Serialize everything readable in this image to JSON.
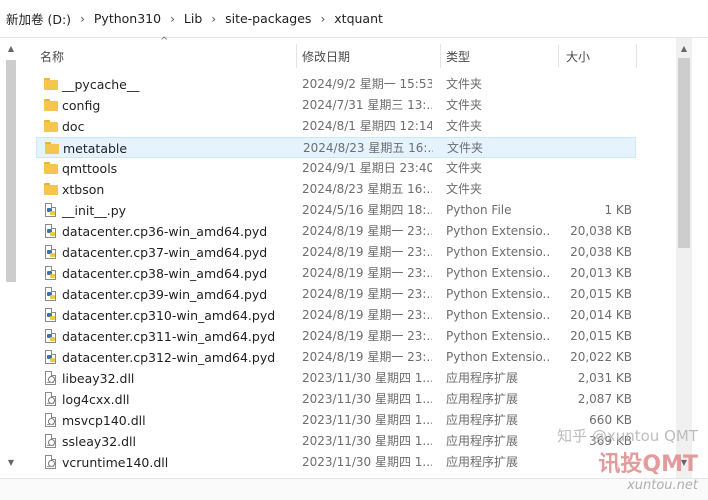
{
  "breadcrumb": [
    {
      "label": "新加卷 (D:)"
    },
    {
      "label": "Python310"
    },
    {
      "label": "Lib"
    },
    {
      "label": "site-packages"
    },
    {
      "label": "xtquant"
    }
  ],
  "separator_glyph": "›",
  "columns": {
    "name": "名称",
    "date": "修改日期",
    "type": "类型",
    "size": "大小"
  },
  "icons": {
    "folder": "folder-icon",
    "python": "python-file-icon",
    "pyd": "python-extension-icon",
    "dll": "dll-file-icon"
  },
  "rows": [
    {
      "name": "__pycache__",
      "date": "2024/9/2 星期一 15:53",
      "type": "文件夹",
      "size": "",
      "kind": "folder"
    },
    {
      "name": "config",
      "date": "2024/7/31 星期三 13:...",
      "type": "文件夹",
      "size": "",
      "kind": "folder"
    },
    {
      "name": "doc",
      "date": "2024/8/1 星期四 12:14",
      "type": "文件夹",
      "size": "",
      "kind": "folder"
    },
    {
      "name": "metatable",
      "date": "2024/8/23 星期五 16:...",
      "type": "文件夹",
      "size": "",
      "kind": "folder",
      "selected": true
    },
    {
      "name": "qmttools",
      "date": "2024/9/1 星期日 23:40",
      "type": "文件夹",
      "size": "",
      "kind": "folder"
    },
    {
      "name": "xtbson",
      "date": "2024/8/23 星期五 16:...",
      "type": "文件夹",
      "size": "",
      "kind": "folder"
    },
    {
      "name": "__init__.py",
      "date": "2024/5/16 星期四 18:...",
      "type": "Python File",
      "size": "1 KB",
      "kind": "python"
    },
    {
      "name": "datacenter.cp36-win_amd64.pyd",
      "date": "2024/8/19 星期一 23:...",
      "type": "Python Extensio...",
      "size": "20,038 KB",
      "kind": "pyd"
    },
    {
      "name": "datacenter.cp37-win_amd64.pyd",
      "date": "2024/8/19 星期一 23:...",
      "type": "Python Extensio...",
      "size": "20,038 KB",
      "kind": "pyd"
    },
    {
      "name": "datacenter.cp38-win_amd64.pyd",
      "date": "2024/8/19 星期一 23:...",
      "type": "Python Extensio...",
      "size": "20,013 KB",
      "kind": "pyd"
    },
    {
      "name": "datacenter.cp39-win_amd64.pyd",
      "date": "2024/8/19 星期一 23:...",
      "type": "Python Extensio...",
      "size": "20,015 KB",
      "kind": "pyd"
    },
    {
      "name": "datacenter.cp310-win_amd64.pyd",
      "date": "2024/8/19 星期一 23:...",
      "type": "Python Extensio...",
      "size": "20,014 KB",
      "kind": "pyd"
    },
    {
      "name": "datacenter.cp311-win_amd64.pyd",
      "date": "2024/8/19 星期一 23:...",
      "type": "Python Extensio...",
      "size": "20,015 KB",
      "kind": "pyd"
    },
    {
      "name": "datacenter.cp312-win_amd64.pyd",
      "date": "2024/8/19 星期一 23:...",
      "type": "Python Extensio...",
      "size": "20,022 KB",
      "kind": "pyd"
    },
    {
      "name": "libeay32.dll",
      "date": "2023/11/30 星期四 1...",
      "type": "应用程序扩展",
      "size": "2,031 KB",
      "kind": "dll"
    },
    {
      "name": "log4cxx.dll",
      "date": "2023/11/30 星期四 1...",
      "type": "应用程序扩展",
      "size": "2,087 KB",
      "kind": "dll"
    },
    {
      "name": "msvcp140.dll",
      "date": "2023/11/30 星期四 1...",
      "type": "应用程序扩展",
      "size": "660 KB",
      "kind": "dll"
    },
    {
      "name": "ssleay32.dll",
      "date": "2023/11/30 星期四 1...",
      "type": "应用程序扩展",
      "size": "369 KB",
      "kind": "dll"
    },
    {
      "name": "vcruntime140.dll",
      "date": "2023/11/30 星期四 1...",
      "type": "应用程序扩展",
      "size": "",
      "kind": "dll"
    }
  ],
  "watermark": {
    "line1": "知乎 @xuntou QMT",
    "line2": "讯投QMT",
    "line3": "xuntou.net"
  },
  "colors": {
    "selection_bg": "#e5f3ff",
    "folder": "#f5c64e",
    "header_text": "#4a4a4a",
    "meta_text": "#6d6d6d"
  }
}
